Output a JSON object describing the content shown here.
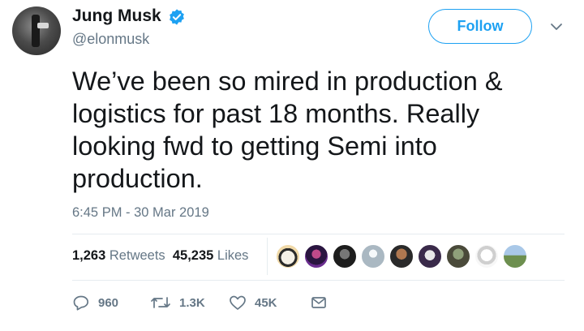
{
  "user": {
    "name": "Jung Musk",
    "handle": "@elonmusk"
  },
  "follow_label": "Follow",
  "tweet_lines": [
    "We’ve been so mired in production &",
    "logistics for past 18 months. Really",
    "looking fwd to getting Semi into",
    "production."
  ],
  "timestamp": "6:45 PM - 30 Mar 2019",
  "stats": {
    "retweets_count": "1,263",
    "retweets_label": "Retweets",
    "likes_count": "45,235",
    "likes_label": "Likes"
  },
  "actions": {
    "reply_count": "960",
    "retweet_count": "1.3K",
    "like_count": "45K"
  },
  "colors": {
    "accent": "#1da1f2",
    "text": "#14171a",
    "secondary": "#657786",
    "divider": "#e6ecf0"
  }
}
